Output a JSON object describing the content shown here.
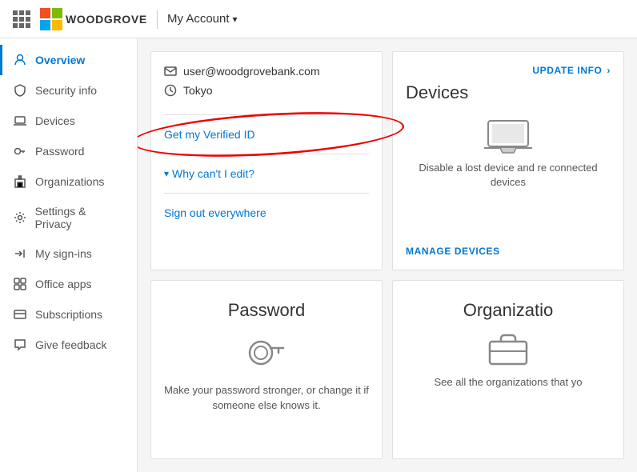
{
  "topnav": {
    "app_name": "WOODGROVE",
    "title": "My Account",
    "chevron": "▾"
  },
  "sidebar": {
    "items": [
      {
        "id": "overview",
        "label": "Overview",
        "icon": "person",
        "active": true
      },
      {
        "id": "security-info",
        "label": "Security info",
        "icon": "shield"
      },
      {
        "id": "devices",
        "label": "Devices",
        "icon": "laptop"
      },
      {
        "id": "password",
        "label": "Password",
        "icon": "key"
      },
      {
        "id": "organizations",
        "label": "Organizations",
        "icon": "building"
      },
      {
        "id": "settings-privacy",
        "label": "Settings & Privacy",
        "icon": "gear"
      },
      {
        "id": "my-sign-ins",
        "label": "My sign-ins",
        "icon": "signin"
      },
      {
        "id": "office-apps",
        "label": "Office apps",
        "icon": "apps"
      },
      {
        "id": "subscriptions",
        "label": "Subscriptions",
        "icon": "subscription"
      },
      {
        "id": "give-feedback",
        "label": "Give feedback",
        "icon": "feedback"
      }
    ]
  },
  "profile_card": {
    "email": "user@woodgrovebank.com",
    "timezone": "Tokyo",
    "verified_id_label": "Get my Verified ID",
    "why_edit_label": "Why can't I edit?",
    "sign_out_label": "Sign out everywhere"
  },
  "devices_card": {
    "update_info_label": "UPDATE INFO",
    "update_info_arrow": "›",
    "title": "Devices",
    "description": "Disable a lost device and re connected devices",
    "manage_label": "MANAGE DEVICES"
  },
  "password_card": {
    "title": "Password",
    "description": "Make your password stronger, or change it if someone else knows it."
  },
  "organizations_card": {
    "title": "Organizatio",
    "description": "See all the organizations that yo"
  }
}
